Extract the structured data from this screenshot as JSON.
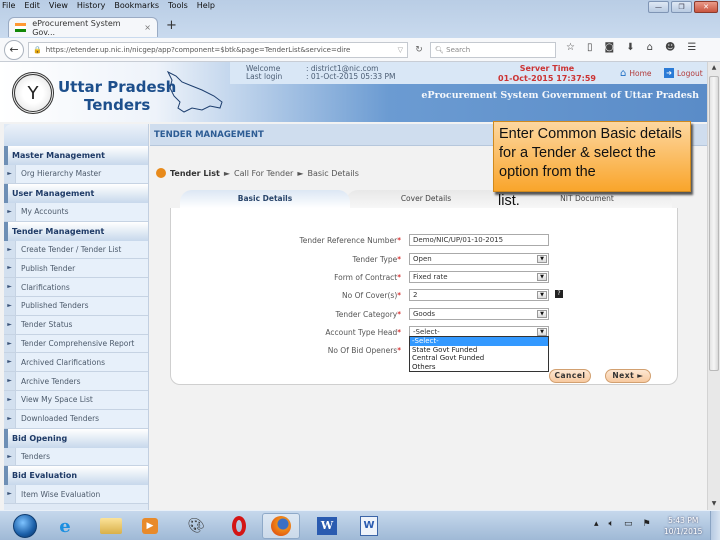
{
  "browser": {
    "menu": [
      "File",
      "Edit",
      "View",
      "History",
      "Bookmarks",
      "Tools",
      "Help"
    ],
    "window_buttons": {
      "minimize": "—",
      "restore": "❐",
      "close": "✕"
    },
    "tab": {
      "title": "eProcurement System Gov...",
      "close": "×"
    },
    "new_tab": "+",
    "url": "https://etender.up.nic.in/nicgep/app?component=$btk&page=TenderList&service=dire",
    "search_placeholder": "Search",
    "toolbar_icons": [
      "star-icon",
      "clipboard-icon",
      "pocket-icon",
      "download-icon",
      "home-icon",
      "chat-icon",
      "menu-icon"
    ]
  },
  "header": {
    "brand_line1": "Uttar Pradesh",
    "brand_line2": "Tenders",
    "welcome_label": "Welcome",
    "welcome_value": ": district1@nic.com",
    "last_login_label": "Last login",
    "last_login_value": ": 01-Oct-2015 05:33 PM",
    "server_time_label": "Server Time",
    "server_time_value": "01-Oct-2015 17:37:59",
    "home_label": "Home",
    "logout_label": "Logout",
    "system_title": "eProcurement System Government of Uttar Pradesh"
  },
  "sidebar": {
    "sections": [
      {
        "title": "Master Management",
        "items": [
          "Org Hierarchy Master"
        ]
      },
      {
        "title": "User Management",
        "items": [
          "My Accounts"
        ]
      },
      {
        "title": "Tender Management",
        "items": [
          "Create Tender / Tender List",
          "Publish Tender",
          "Clarifications",
          "Published Tenders",
          "Tender Status",
          "Tender Comprehensive Report",
          "Archived Clarifications",
          "Archive Tenders",
          "View My Space List",
          "Downloaded Tenders"
        ]
      },
      {
        "title": "Bid Opening",
        "items": [
          "Tenders"
        ]
      },
      {
        "title": "Bid Evaluation",
        "items": [
          "Item Wise Evaluation"
        ]
      }
    ]
  },
  "main": {
    "heading": "TENDER MANAGEMENT",
    "breadcrumb": [
      "Tender List",
      "Call For Tender",
      "Basic Details"
    ],
    "breadcrumb_sep": "►",
    "tabs": [
      "Basic Details",
      "Cover Details",
      "NIT Document"
    ],
    "form": {
      "fields": [
        {
          "label": "Tender Reference Number",
          "type": "input",
          "value": "Demo/NIC/UP/01-10-2015"
        },
        {
          "label": "Tender Type",
          "type": "select",
          "value": "Open"
        },
        {
          "label": "Form of Contract",
          "type": "select",
          "value": "Fixed rate"
        },
        {
          "label": "No Of Cover(s)",
          "type": "select",
          "value": "2",
          "help": "?"
        },
        {
          "label": "Tender Category",
          "type": "select",
          "value": "Goods"
        },
        {
          "label": "Account Type Head",
          "type": "select",
          "value": "-Select-"
        },
        {
          "label": "No Of Bid Openers",
          "type": "select",
          "value": ""
        }
      ],
      "required_mark": "*",
      "dropdown_options": [
        "-Select-",
        "State Govt Funded",
        "Central Govt Funded",
        "Others"
      ],
      "dropdown_selected_index": 0,
      "cancel_label": "Cancel",
      "next_label": "Next ►"
    }
  },
  "callout": {
    "text": "Enter Common Basic details for a Tender & select the option from the",
    "tail": "list."
  },
  "taskbar": {
    "apps": [
      "start-button",
      "internet-explorer",
      "file-explorer",
      "media-player",
      "paint",
      "opera",
      "firefox",
      "word",
      "word-document"
    ],
    "active_app": "firefox",
    "clock_time": "5:43 PM",
    "clock_date": "10/1/2015",
    "tray_icons": [
      "show-hidden-icon",
      "volume-icon",
      "network-icon",
      "action-center-flag-icon"
    ]
  }
}
